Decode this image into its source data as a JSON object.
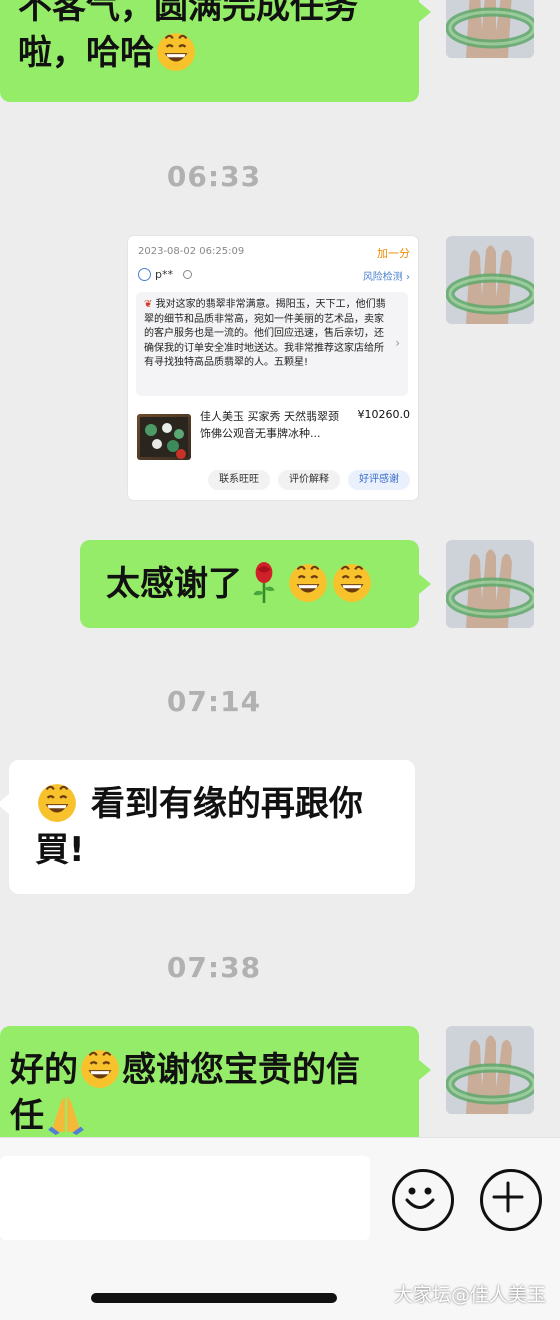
{
  "messages": {
    "m1_line1": "不客气，圆满完成任务",
    "m1_line2": "啦，哈哈",
    "m2": "太感谢了",
    "m3_line1": "看到有缘的再跟你",
    "m3_line2": "買!",
    "m4_part1": "好的",
    "m4_part2": "感谢您宝贵的信",
    "m4_line2": "任"
  },
  "timestamps": [
    "06:33",
    "07:14",
    "07:38"
  ],
  "card": {
    "datetime": "2023-08-02 06:25:09",
    "plus_label": "加一分",
    "user": "p**",
    "risk_label": "风险检测",
    "review": "我对这家的翡翠非常满意。揭阳玉，天下工，他们翡翠的细节和品质非常高，宛如一件美丽的艺术品，卖家的客户服务也是一流的。他们回应迅速，售后亲切，还确保我的订单安全准时地送达。我非常推荐这家店给所有寻找独特高品质翡翠的人。五颗星!",
    "product": "佳人美玉 买家秀 天然翡翠颈饰佛公观音无事牌冰种...",
    "price": "¥10260.0",
    "btn_contact": "联系旺旺",
    "btn_explain": "评价解释",
    "btn_thanks": "好评感谢"
  },
  "watermark": "大家坛@佳人美玉",
  "icons": [
    "grinning-emoji",
    "rose-emoji",
    "folded-hands-emoji",
    "smiley-icon",
    "plus-icon"
  ],
  "colors": {
    "sent_bubble": "#95ec69",
    "received_bubble": "#ffffff",
    "background": "#ededed"
  }
}
